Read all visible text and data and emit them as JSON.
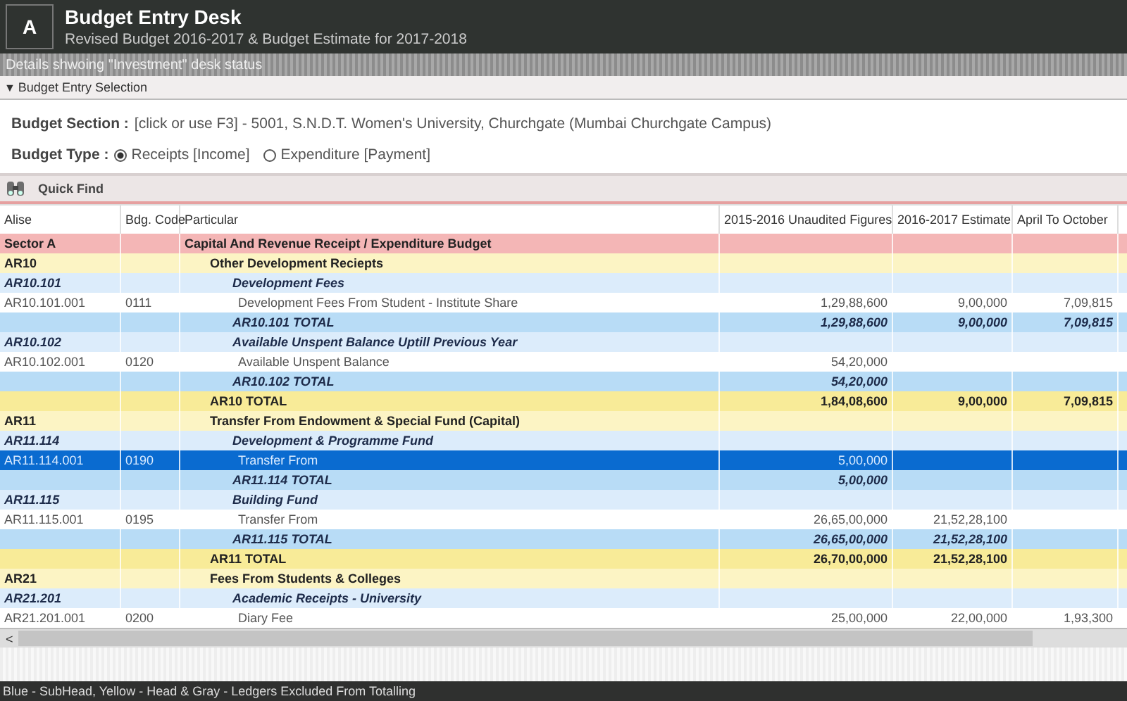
{
  "header": {
    "badge": "A",
    "title": "Budget Entry Desk",
    "subtitle": "Revised Budget 2016-2017 & Budget Estimate for 2017-2018"
  },
  "status_strip": "Details shwoing \"Investment\" desk status",
  "selection_panel": {
    "toggle": "▼",
    "title": "Budget Entry Selection",
    "expanded": true,
    "section_label": "Budget Section :",
    "section_value": "[click or use F3] - 5001, S.N.D.T. Women's University, Churchgate (Mumbai Churchgate Campus)",
    "type_label": "Budget Type :",
    "types": [
      {
        "label": "Receipts [Income]",
        "selected": true
      },
      {
        "label": "Expenditure [Payment]",
        "selected": false
      }
    ]
  },
  "quick_find": {
    "label": "Quick Find"
  },
  "table": {
    "columns": [
      "Alise",
      "Bdg. Code",
      "Particular",
      "2015-2016 Unaudited Figures",
      "2016-2017 Estimate",
      "April To October"
    ],
    "rows": [
      {
        "kind": "sector",
        "cells": [
          "Sector A",
          "",
          "Capital And Revenue Receipt / Expenditure Budget",
          "",
          "",
          ""
        ],
        "selected": false
      },
      {
        "kind": "head",
        "cells": [
          "AR10",
          "",
          "Other Development Reciepts",
          "",
          "",
          ""
        ],
        "selected": false
      },
      {
        "kind": "subhead",
        "cells": [
          "AR10.101",
          "",
          "Development Fees",
          "",
          "",
          ""
        ],
        "selected": false
      },
      {
        "kind": "ledger",
        "cells": [
          "AR10.101.001",
          "0111",
          "Development Fees From Student - Institute Share",
          "1,29,88,600",
          "9,00,000",
          "7,09,815"
        ],
        "selected": false
      },
      {
        "kind": "subtotal",
        "cells": [
          "",
          "",
          "AR10.101 TOTAL",
          "1,29,88,600",
          "9,00,000",
          "7,09,815"
        ],
        "selected": false
      },
      {
        "kind": "subhead",
        "cells": [
          "AR10.102",
          "",
          "Available Unspent Balance Uptill Previous Year",
          "",
          "",
          ""
        ],
        "selected": false
      },
      {
        "kind": "ledger",
        "cells": [
          "AR10.102.001",
          "0120",
          "Available Unspent Balance",
          "54,20,000",
          "",
          ""
        ],
        "selected": false
      },
      {
        "kind": "subtotal",
        "cells": [
          "",
          "",
          "AR10.102 TOTAL",
          "54,20,000",
          "",
          ""
        ],
        "selected": false
      },
      {
        "kind": "headtotal",
        "cells": [
          "",
          "",
          "AR10 TOTAL",
          "1,84,08,600",
          "9,00,000",
          "7,09,815"
        ],
        "selected": false
      },
      {
        "kind": "head",
        "cells": [
          "AR11",
          "",
          "Transfer From Endowment & Special Fund (Capital)",
          "",
          "",
          ""
        ],
        "selected": false
      },
      {
        "kind": "subhead",
        "cells": [
          "AR11.114",
          "",
          "Development & Programme Fund",
          "",
          "",
          ""
        ],
        "selected": false
      },
      {
        "kind": "ledger",
        "cells": [
          "AR11.114.001",
          "0190",
          "Transfer From",
          "5,00,000",
          "",
          ""
        ],
        "selected": true
      },
      {
        "kind": "subtotal",
        "cells": [
          "",
          "",
          "AR11.114 TOTAL",
          "5,00,000",
          "",
          ""
        ],
        "selected": false
      },
      {
        "kind": "subhead",
        "cells": [
          "AR11.115",
          "",
          "Building Fund",
          "",
          "",
          ""
        ],
        "selected": false
      },
      {
        "kind": "ledger",
        "cells": [
          "AR11.115.001",
          "0195",
          "Transfer From",
          "26,65,00,000",
          "21,52,28,100",
          ""
        ],
        "selected": false
      },
      {
        "kind": "subtotal",
        "cells": [
          "",
          "",
          "AR11.115 TOTAL",
          "26,65,00,000",
          "21,52,28,100",
          ""
        ],
        "selected": false
      },
      {
        "kind": "headtotal",
        "cells": [
          "",
          "",
          "AR11 TOTAL",
          "26,70,00,000",
          "21,52,28,100",
          ""
        ],
        "selected": false
      },
      {
        "kind": "head",
        "cells": [
          "AR21",
          "",
          "Fees From Students & Colleges",
          "",
          "",
          ""
        ],
        "selected": false
      },
      {
        "kind": "subhead",
        "cells": [
          "AR21.201",
          "",
          "Academic Receipts - University",
          "",
          "",
          ""
        ],
        "selected": false
      },
      {
        "kind": "ledger",
        "cells": [
          "AR21.201.001",
          "0200",
          "Diary  Fee",
          "25,00,000",
          "22,00,000",
          "1,93,300"
        ],
        "selected": false
      }
    ]
  },
  "scrollbar": {
    "left_arrow": "<"
  },
  "legend": "Blue - SubHead, Yellow - Head & Gray - Ledgers Excluded From Totalling"
}
